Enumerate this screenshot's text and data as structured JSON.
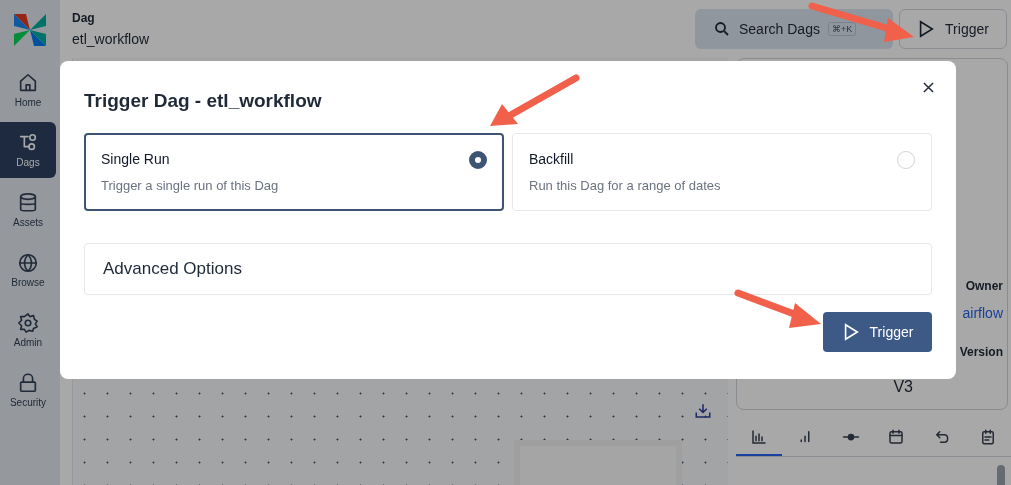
{
  "sidebar": {
    "items": [
      {
        "kind": "home",
        "label": "Home",
        "selected": false
      },
      {
        "kind": "dags",
        "label": "Dags",
        "selected": true
      },
      {
        "kind": "assets",
        "label": "Assets",
        "selected": false
      },
      {
        "kind": "browse",
        "label": "Browse",
        "selected": false
      },
      {
        "kind": "admin",
        "label": "Admin",
        "selected": false
      },
      {
        "kind": "security",
        "label": "Security",
        "selected": false
      }
    ]
  },
  "header": {
    "breadcrumb": "Dag",
    "dag_name": "etl_workflow",
    "search": {
      "label": "Search Dags",
      "shortcut": "⌘+K"
    },
    "trigger_button": "Trigger"
  },
  "details": {
    "fields": [
      {
        "label": "Owner",
        "value": "airflow",
        "kind": "link"
      },
      {
        "label": "Version",
        "value": "V3",
        "kind": "text"
      }
    ],
    "tabs": [
      {
        "kind": "bars",
        "selected": true
      },
      {
        "kind": "signal",
        "selected": false
      },
      {
        "kind": "commit",
        "selected": false
      },
      {
        "kind": "calendar",
        "selected": false
      },
      {
        "kind": "undo",
        "selected": false
      },
      {
        "kind": "note",
        "selected": false
      }
    ]
  },
  "modal": {
    "title": "Trigger Dag - etl_workflow",
    "options": [
      {
        "title": "Single Run",
        "description": "Trigger a single run of this Dag",
        "selected": true
      },
      {
        "title": "Backfill",
        "description": "Run this Dag for a range of dates",
        "selected": false
      }
    ],
    "advanced_options": "Advanced Options",
    "trigger_button": "Trigger"
  }
}
